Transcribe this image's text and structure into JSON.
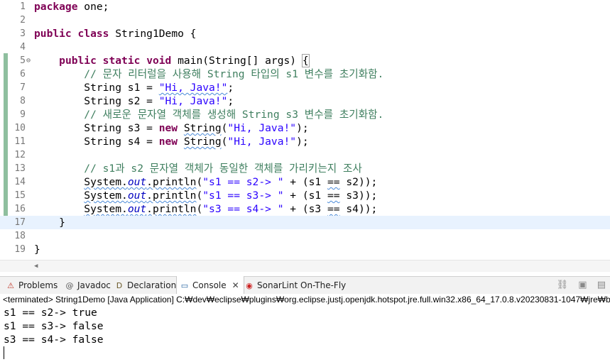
{
  "editor": {
    "lines": [
      {
        "n": "1",
        "tokens": [
          {
            "t": "kw",
            "v": "package"
          },
          {
            "t": "plain",
            "v": " one;"
          }
        ]
      },
      {
        "n": "2",
        "tokens": []
      },
      {
        "n": "3",
        "tokens": [
          {
            "t": "kw",
            "v": "public"
          },
          {
            "t": "plain",
            "v": " "
          },
          {
            "t": "kw",
            "v": "class"
          },
          {
            "t": "plain",
            "v": " String1Demo {"
          }
        ]
      },
      {
        "n": "4",
        "tokens": []
      },
      {
        "n": "5",
        "fold": "⊖",
        "tokens": [
          {
            "t": "plain",
            "v": "    "
          },
          {
            "t": "kw",
            "v": "public"
          },
          {
            "t": "plain",
            "v": " "
          },
          {
            "t": "kw",
            "v": "static"
          },
          {
            "t": "plain",
            "v": " "
          },
          {
            "t": "kw",
            "v": "void"
          },
          {
            "t": "plain",
            "v": " main(String[] args) "
          },
          {
            "t": "brace",
            "v": "{"
          }
        ]
      },
      {
        "n": "6",
        "tokens": [
          {
            "t": "cmt",
            "v": "        // 문자 리터럴을 사용해 String 타입의 s1 변수를 초기화함."
          }
        ]
      },
      {
        "n": "7",
        "tokens": [
          {
            "t": "plain",
            "v": "        String s1 = "
          },
          {
            "t": "strsq",
            "v": "\"Hi, Java!\""
          },
          {
            "t": "plain",
            "v": ";"
          }
        ]
      },
      {
        "n": "8",
        "tokens": [
          {
            "t": "plain",
            "v": "        String s2 = "
          },
          {
            "t": "str",
            "v": "\"Hi, Java!\""
          },
          {
            "t": "plain",
            "v": ";"
          }
        ]
      },
      {
        "n": "9",
        "tokens": [
          {
            "t": "cmt",
            "v": "        // 새로운 문자열 객체를 생성해 String s3 변수를 초기화함."
          }
        ]
      },
      {
        "n": "10",
        "tokens": [
          {
            "t": "plain",
            "v": "        String s3 = "
          },
          {
            "t": "kw",
            "v": "new"
          },
          {
            "t": "plain",
            "v": " "
          },
          {
            "t": "sq",
            "v": "String"
          },
          {
            "t": "plain",
            "v": "("
          },
          {
            "t": "str",
            "v": "\"Hi, Java!\""
          },
          {
            "t": "plain",
            "v": ");"
          }
        ]
      },
      {
        "n": "11",
        "tokens": [
          {
            "t": "plain",
            "v": "        String s4 = "
          },
          {
            "t": "kw",
            "v": "new"
          },
          {
            "t": "plain",
            "v": " "
          },
          {
            "t": "sq",
            "v": "String"
          },
          {
            "t": "plain",
            "v": "("
          },
          {
            "t": "str",
            "v": "\"Hi, Java!\""
          },
          {
            "t": "plain",
            "v": ");"
          }
        ]
      },
      {
        "n": "12",
        "tokens": []
      },
      {
        "n": "13",
        "tokens": [
          {
            "t": "cmt",
            "v": "        // s1과 s2 문자열 객체가 동일한 객체를 가리키는지 조사"
          }
        ]
      },
      {
        "n": "14",
        "tokens": [
          {
            "t": "plain",
            "v": "        "
          },
          {
            "t": "sq",
            "v": "System."
          },
          {
            "t": "statsq",
            "v": "out"
          },
          {
            "t": "sq",
            "v": ".println"
          },
          {
            "t": "plain",
            "v": "("
          },
          {
            "t": "str",
            "v": "\"s1 == s2-> \""
          },
          {
            "t": "plain",
            "v": " + (s1 "
          },
          {
            "t": "sq",
            "v": "=="
          },
          {
            "t": "plain",
            "v": " s2));"
          }
        ]
      },
      {
        "n": "15",
        "tokens": [
          {
            "t": "plain",
            "v": "        "
          },
          {
            "t": "sq",
            "v": "System."
          },
          {
            "t": "statsq",
            "v": "out"
          },
          {
            "t": "sq",
            "v": ".println"
          },
          {
            "t": "plain",
            "v": "("
          },
          {
            "t": "str",
            "v": "\"s1 == s3-> \""
          },
          {
            "t": "plain",
            "v": " + (s1 "
          },
          {
            "t": "sq",
            "v": "=="
          },
          {
            "t": "plain",
            "v": " s3));"
          }
        ]
      },
      {
        "n": "16",
        "tokens": [
          {
            "t": "plain",
            "v": "        "
          },
          {
            "t": "sq",
            "v": "System."
          },
          {
            "t": "statsq",
            "v": "out"
          },
          {
            "t": "sq",
            "v": ".println"
          },
          {
            "t": "plain",
            "v": "("
          },
          {
            "t": "str",
            "v": "\"s3 == s4-> \""
          },
          {
            "t": "plain",
            "v": " + (s3 "
          },
          {
            "t": "sq",
            "v": "=="
          },
          {
            "t": "plain",
            "v": " s4));"
          }
        ]
      },
      {
        "n": "17",
        "current": true,
        "tokens": [
          {
            "t": "plain",
            "v": "    }"
          }
        ]
      },
      {
        "n": "18",
        "tokens": []
      },
      {
        "n": "19",
        "tokens": [
          {
            "t": "plain",
            "v": "}"
          }
        ]
      }
    ]
  },
  "tabs": [
    {
      "label": "Problems",
      "icon": "problems-icon",
      "glyph": "⚠",
      "color": "#c0392b"
    },
    {
      "label": "Javadoc",
      "icon": "javadoc-icon",
      "glyph": "@",
      "color": "#555555"
    },
    {
      "label": "Declaration",
      "icon": "declaration-icon",
      "glyph": "D",
      "color": "#6b5a2a"
    },
    {
      "label": "Console",
      "icon": "console-icon",
      "glyph": "▭",
      "color": "#1f5f9f",
      "active": true,
      "close": "✕"
    },
    {
      "label": "SonarLint On-The-Fly",
      "icon": "sonarlint-icon",
      "glyph": "◉",
      "color": "#cc2222"
    }
  ],
  "console": {
    "header": "<terminated> String1Demo [Java Application] C:₩dev₩eclipse₩plugins₩org.eclipse.justj.openjdk.hotspot.jre.full.win32.x86_64_17.0.8.v20230831-1047₩jre₩b",
    "output": [
      "s1 == s2-> true",
      "s1 == s3-> false",
      "s3 == s4-> false"
    ]
  }
}
